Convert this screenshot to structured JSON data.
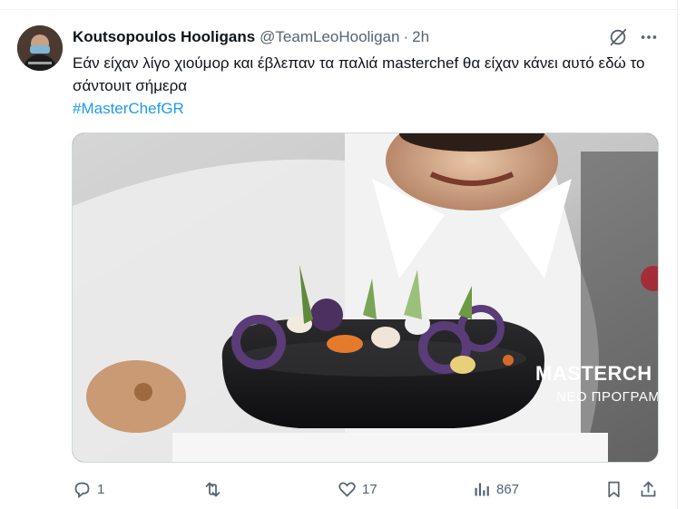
{
  "tweet": {
    "display_name": "Koutsopoulos Hooligans",
    "handle": "@TeamLeoHooligan",
    "separator": "·",
    "time": "2h",
    "text": "Εάν είχαν λίγο χιούμορ και έβλεπαν τα παλιά masterchef θα είχαν κάνει αυτό εδώ το σάντουιτ σήμερα",
    "hashtag": "#MasterChefGR",
    "media": {
      "caption_line1": "MASTERCH",
      "caption_line2": "ΝΕΟ ΠΡΟΓΡΑΜ"
    }
  },
  "actions": {
    "replies": "1",
    "reposts": "",
    "likes": "17",
    "views": "867"
  },
  "icons": {
    "reply": "reply-icon",
    "repost": "repost-icon",
    "like": "heart-icon",
    "views": "views-icon",
    "bookmark": "bookmark-icon",
    "share": "share-icon",
    "grok": "grok-icon",
    "more": "more-icon"
  },
  "colors": {
    "text": "#0f1419",
    "secondary": "#536471",
    "link": "#1d9bf0",
    "border": "#eff3f4"
  }
}
